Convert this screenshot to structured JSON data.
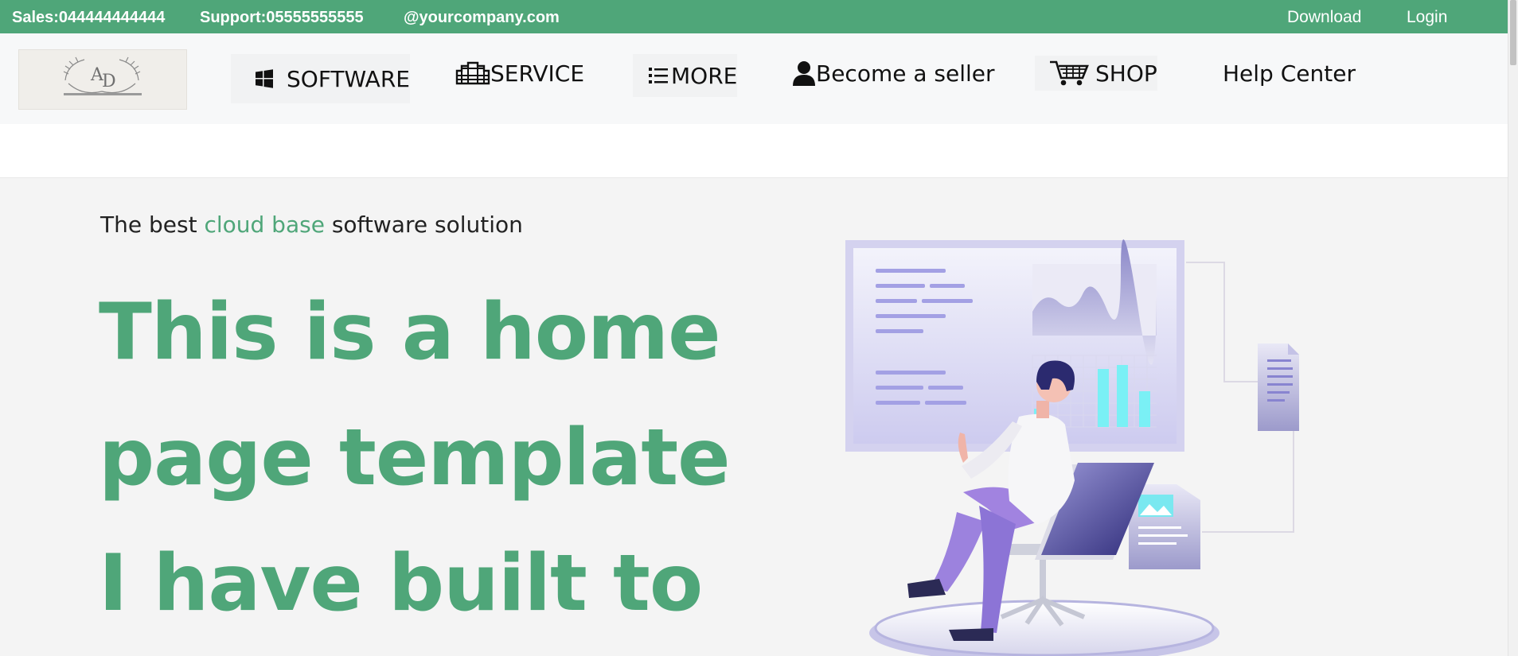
{
  "topbar": {
    "sales": "Sales:044444444444",
    "support": "Support:05555555555",
    "email": "@yourcompany.com",
    "download": "Download",
    "login": "Login"
  },
  "nav": {
    "items": [
      {
        "label": "SOFTWARE",
        "icon": "windows-icon"
      },
      {
        "label": "SERVICE",
        "icon": "building-icon"
      },
      {
        "label": "MORE",
        "icon": "list-icon"
      },
      {
        "label": "Become a seller",
        "icon": "user-icon"
      },
      {
        "label": "SHOP",
        "icon": "cart-icon"
      },
      {
        "label": "Help Center",
        "icon": ""
      }
    ]
  },
  "hero": {
    "tagline_pre": "The best ",
    "tagline_accent": "cloud base",
    "tagline_post": " software solution",
    "headline": "This is a home page template I have built to"
  },
  "colors": {
    "brand_green": "#4fa679",
    "illustration_purple": "#8f8bdc",
    "illustration_cyan": "#7af0f5"
  }
}
